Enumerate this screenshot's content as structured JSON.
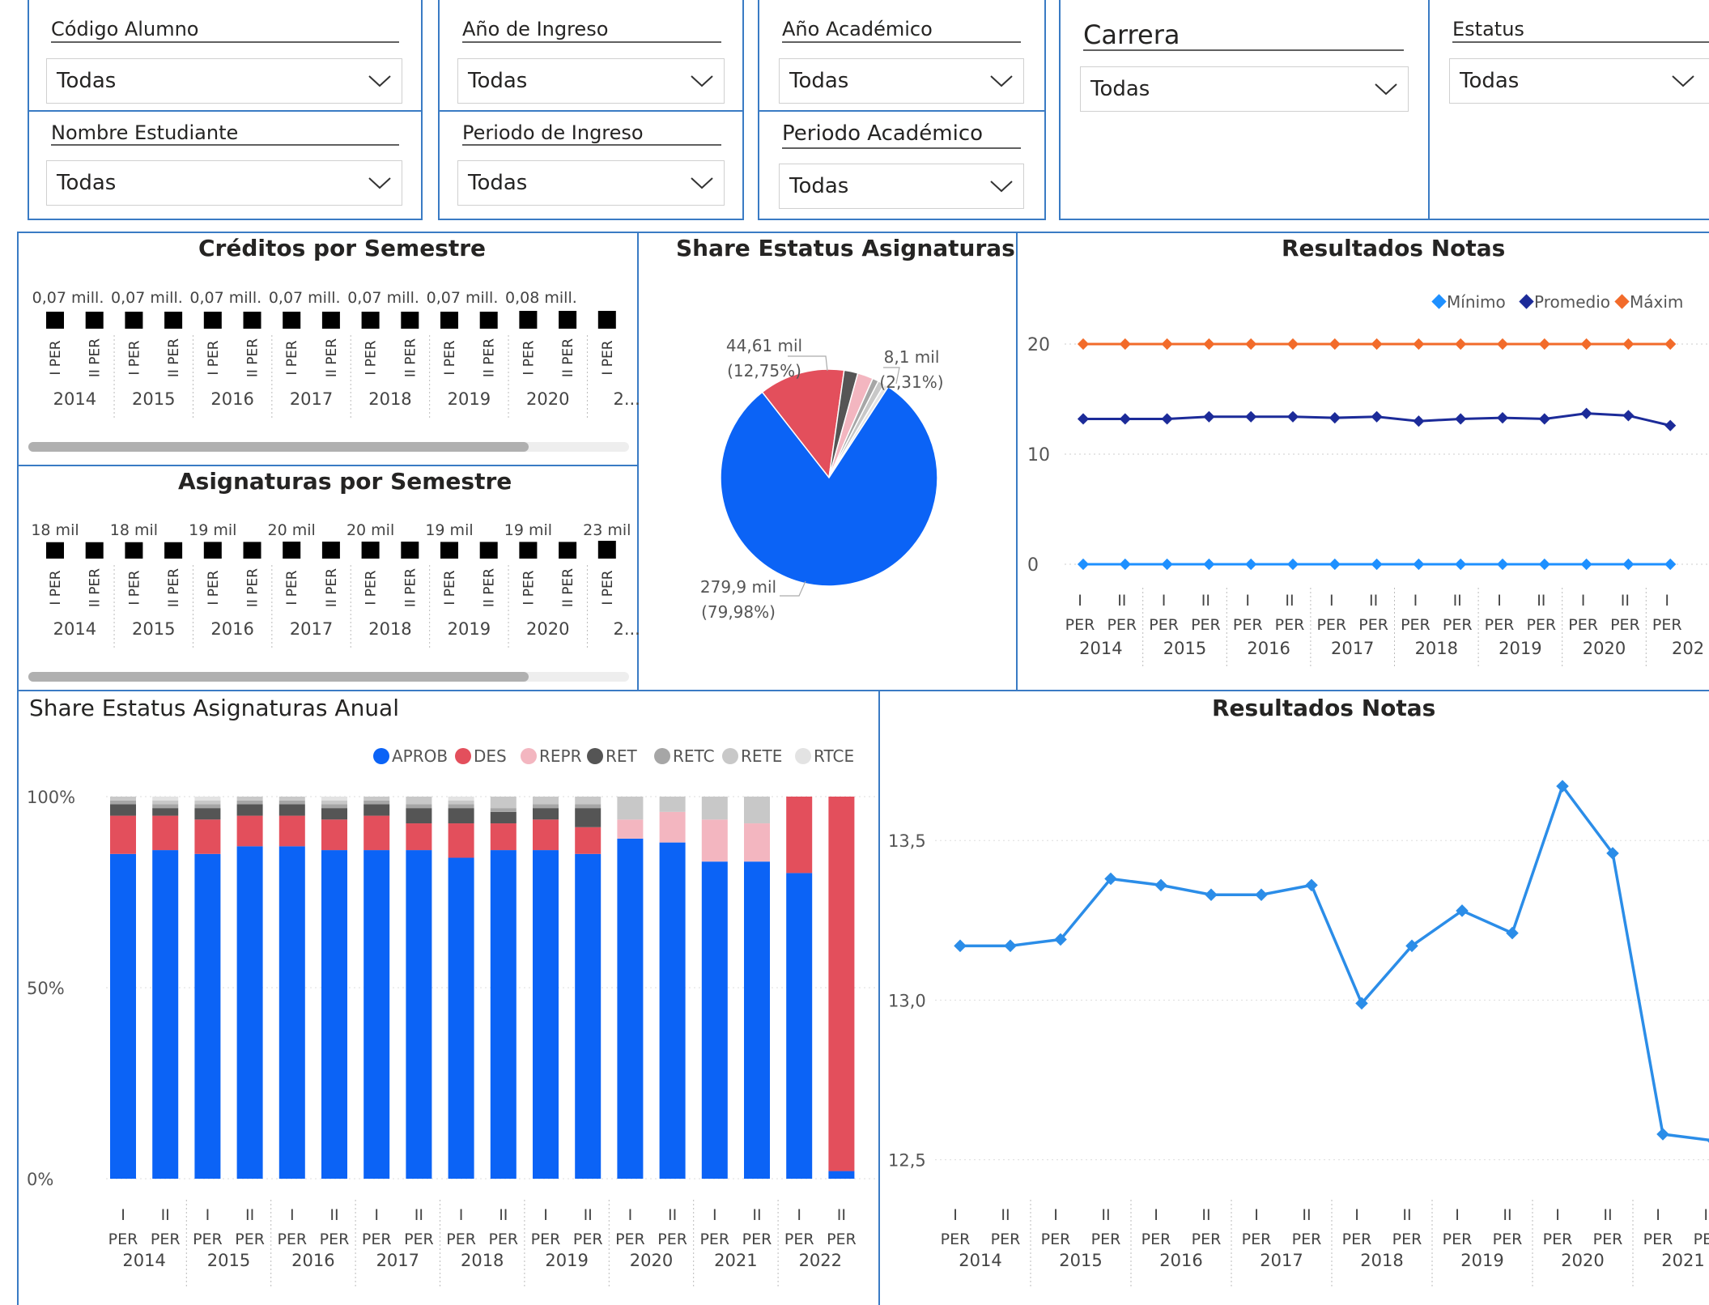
{
  "filters": [
    {
      "key": "codigo",
      "label": "Código Alumno",
      "value": "Todas"
    },
    {
      "key": "nombre",
      "label": "Nombre Estudiante",
      "value": "Todas"
    },
    {
      "key": "anio_ingreso",
      "label": "Año de Ingreso",
      "value": "Todas"
    },
    {
      "key": "periodo_ingreso",
      "label": "Periodo de Ingreso",
      "value": "Todas"
    },
    {
      "key": "anio_academico",
      "label": "Año Académico",
      "value": "Todas"
    },
    {
      "key": "periodo_academico",
      "label": "Periodo Académico",
      "value": "Todas"
    },
    {
      "key": "carrera",
      "label": "Carrera",
      "value": "Todas"
    },
    {
      "key": "estatus",
      "label": "Estatus",
      "value": "Todas"
    }
  ],
  "colors": {
    "border": "#3a7bc4",
    "aprob": "#0b63f6",
    "des": "#e34f5c",
    "repr": "#f3b6c0",
    "ret": "#555555",
    "retc": "#a6a6a6",
    "rete": "#c8c8c8",
    "rtce": "#e3e3e3",
    "minimo": "#1e90ff",
    "promedio": "#1c2b99",
    "maximo": "#f26b2a",
    "line": "#2b8de8"
  },
  "chart_data": [
    {
      "id": "creditos",
      "type": "bar",
      "title": "Créditos por Semestre",
      "categories": [
        "I PER",
        "II PER",
        "I PER",
        "II PER",
        "I PER",
        "II PER",
        "I PER",
        "II PER",
        "I PER",
        "II PER",
        "I PER",
        "II PER",
        "I PER",
        "II PER",
        "I PER"
      ],
      "groups": [
        "2014",
        "2015",
        "2016",
        "2017",
        "2018",
        "2019",
        "2020",
        "2..."
      ],
      "values": [
        0.07,
        0.07,
        0.07,
        0.07,
        0.07,
        0.07,
        0.07,
        0.07,
        0.07,
        0.07,
        0.07,
        0.07,
        0.08,
        0.08,
        0.08
      ],
      "data_labels": [
        "0,07 mill.",
        "",
        "0,07 mill.",
        "",
        "0,07 mill.",
        "",
        "0,07 mill.",
        "",
        "0,07 mill.",
        "",
        "0,07 mill.",
        "",
        "0,08 mill.",
        "",
        ""
      ]
    },
    {
      "id": "asignaturas",
      "type": "bar",
      "title": "Asignaturas por Semestre",
      "categories": [
        "I PER",
        "II PER",
        "I PER",
        "II PER",
        "I PER",
        "II PER",
        "I PER",
        "II PER",
        "I PER",
        "II PER",
        "I PER",
        "II PER",
        "I PER",
        "II PER",
        "I PER"
      ],
      "groups": [
        "2014",
        "2015",
        "2016",
        "2017",
        "2018",
        "2019",
        "2020",
        "2..."
      ],
      "values": [
        18,
        18,
        18,
        18,
        19,
        19,
        20,
        20,
        20,
        20,
        19,
        19,
        19,
        19,
        23
      ],
      "data_labels": [
        "18 mil",
        "",
        "18 mil",
        "",
        "19 mil",
        "",
        "20 mil",
        "",
        "20 mil",
        "",
        "19 mil",
        "",
        "19 mil",
        "",
        "23 mil"
      ]
    },
    {
      "id": "share",
      "type": "pie",
      "title": "Share Estatus Asignaturas",
      "slices": [
        {
          "value": 279.9,
          "label": "279,9 mil",
          "pct": "(79,98%)",
          "color": "#0b63f6"
        },
        {
          "value": 44.61,
          "label": "44,61 mil",
          "pct": "(12,75%)",
          "color": "#e34f5c"
        },
        {
          "value": 7.2,
          "label": "",
          "pct": "",
          "color": "#555555"
        },
        {
          "value": 8.1,
          "label": "8,1 mil",
          "pct": "(2,31%)",
          "color": "#f3b6c0"
        },
        {
          "value": 3.2,
          "label": "",
          "pct": "",
          "color": "#a6a6a6"
        },
        {
          "value": 3.5,
          "label": "",
          "pct": "",
          "color": "#c8c8c8"
        },
        {
          "value": 2.3,
          "label": "",
          "pct": "",
          "color": "#e3e3e3"
        }
      ]
    },
    {
      "id": "notas1",
      "type": "line",
      "title": "Resultados Notas",
      "legend": [
        "Mínimo",
        "Promedio",
        "Máxim"
      ],
      "y_ticks": [
        "20",
        "10",
        "0"
      ],
      "ylim": [
        0,
        20
      ],
      "x": [
        "I PER",
        "II PER",
        "I PER",
        "II PER",
        "I PER",
        "II PER",
        "I PER",
        "II PER",
        "I PER",
        "II PER",
        "I PER",
        "II PER",
        "I PER",
        "II PER",
        "I PER"
      ],
      "groups": [
        "2014",
        "2015",
        "2016",
        "2017",
        "2018",
        "2019",
        "2020",
        "202"
      ],
      "series": [
        {
          "name": "Máxim",
          "values": [
            20,
            20,
            20,
            20,
            20,
            20,
            20,
            20,
            20,
            20,
            20,
            20,
            20,
            20,
            20
          ]
        },
        {
          "name": "Promedio",
          "values": [
            13.2,
            13.2,
            13.2,
            13.4,
            13.4,
            13.4,
            13.3,
            13.4,
            13.0,
            13.2,
            13.3,
            13.2,
            13.7,
            13.5,
            12.6
          ]
        },
        {
          "name": "Mínimo",
          "values": [
            0,
            0,
            0,
            0,
            0,
            0,
            0,
            0,
            0,
            0,
            0,
            0,
            0,
            0,
            0
          ]
        }
      ]
    },
    {
      "id": "anual",
      "type": "bar",
      "stacked": true,
      "title": "Share Estatus Asignaturas Anual",
      "legend": [
        "APROB",
        "DES",
        "REPR",
        "RET",
        "RETC",
        "RETE",
        "RTCE"
      ],
      "y_ticks": [
        "100%",
        "50%",
        "0%"
      ],
      "x": [
        "I PER",
        "II PER",
        "I PER",
        "II PER",
        "I PER",
        "II PER",
        "I PER",
        "II PER",
        "I PER",
        "II PER",
        "I PER",
        "II PER",
        "I PER",
        "II PER",
        "I PER",
        "II PER",
        "I PER",
        "II PER"
      ],
      "groups": [
        "2014",
        "2015",
        "2016",
        "2017",
        "2018",
        "2019",
        "2020",
        "2021",
        "2022"
      ],
      "series": [
        {
          "name": "APROB",
          "values": [
            85,
            86,
            85,
            87,
            87,
            86,
            86,
            86,
            84,
            86,
            86,
            85,
            89,
            88,
            83,
            83,
            80,
            2
          ]
        },
        {
          "name": "DES",
          "values": [
            10,
            9,
            9,
            8,
            8,
            8,
            9,
            7,
            9,
            7,
            8,
            7,
            0,
            0,
            0,
            0,
            20,
            98
          ]
        },
        {
          "name": "REPR",
          "values": [
            0,
            0,
            0,
            0,
            0,
            0,
            0,
            0,
            0,
            0,
            0,
            0,
            5,
            8,
            11,
            10,
            0,
            0
          ]
        },
        {
          "name": "RET",
          "values": [
            3,
            2,
            3,
            3,
            3,
            3,
            3,
            4,
            4,
            3,
            3,
            5,
            0,
            0,
            0,
            0,
            0,
            0
          ]
        },
        {
          "name": "RETC",
          "values": [
            1,
            1,
            1,
            1,
            1,
            1,
            1,
            1,
            1,
            1,
            1,
            1,
            0,
            0,
            0,
            0,
            0,
            0
          ]
        },
        {
          "name": "RETE",
          "values": [
            1,
            1,
            1,
            1,
            1,
            1,
            1,
            2,
            1,
            3,
            2,
            2,
            6,
            4,
            6,
            7,
            0,
            0
          ]
        },
        {
          "name": "RTCE",
          "values": [
            0,
            1,
            1,
            0,
            0,
            1,
            0,
            0,
            1,
            0,
            0,
            0,
            0,
            0,
            0,
            0,
            0,
            0
          ]
        }
      ]
    },
    {
      "id": "notas2",
      "type": "line",
      "title": "Resultados Notas",
      "y_ticks": [
        "13,5",
        "13,0",
        "12,5"
      ],
      "ylim": [
        12.4,
        13.82
      ],
      "x": [
        "I PER",
        "II PER",
        "I PER",
        "II PER",
        "I PER",
        "II PER",
        "I PER",
        "II PER",
        "I PER",
        "II PER",
        "I PER",
        "II PER",
        "I PER",
        "II PER",
        "I PER",
        "II PER"
      ],
      "groups": [
        "2014",
        "2015",
        "2016",
        "2017",
        "2018",
        "2019",
        "2020",
        "2021"
      ],
      "series": [
        {
          "name": "Promedio",
          "values": [
            13.17,
            13.17,
            13.19,
            13.38,
            13.36,
            13.33,
            13.33,
            13.36,
            12.99,
            13.17,
            13.28,
            13.21,
            13.67,
            13.46,
            12.58,
            12.56
          ]
        }
      ]
    }
  ]
}
